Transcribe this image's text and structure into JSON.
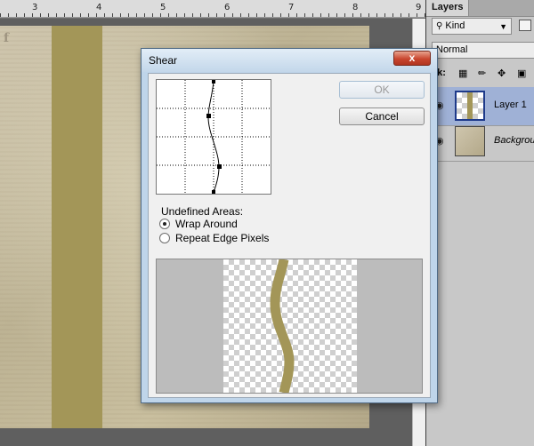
{
  "ruler": {
    "labels": [
      "3",
      "4",
      "5",
      "6",
      "7",
      "8",
      "9"
    ]
  },
  "document": {
    "corner_mark": "f"
  },
  "layers_panel": {
    "tab_label": "Layers",
    "filter_kind": "Kind",
    "blend_mode": "Normal",
    "lock_label": "ck:",
    "layers": [
      {
        "name": "Layer 1",
        "selected": true
      },
      {
        "name": "Background",
        "selected": false
      }
    ]
  },
  "dialog": {
    "title": "Shear",
    "close_symbol": "x",
    "ok_label": "OK",
    "cancel_label": "Cancel",
    "undefined_areas_label": "Undefined Areas:",
    "options": [
      {
        "label": "Wrap Around",
        "selected": true
      },
      {
        "label": "Repeat Edge Pixels",
        "selected": false
      }
    ]
  },
  "colors": {
    "stripe": "#a39658",
    "selection": "#9fb1d6",
    "close_button": "#c9462f"
  }
}
